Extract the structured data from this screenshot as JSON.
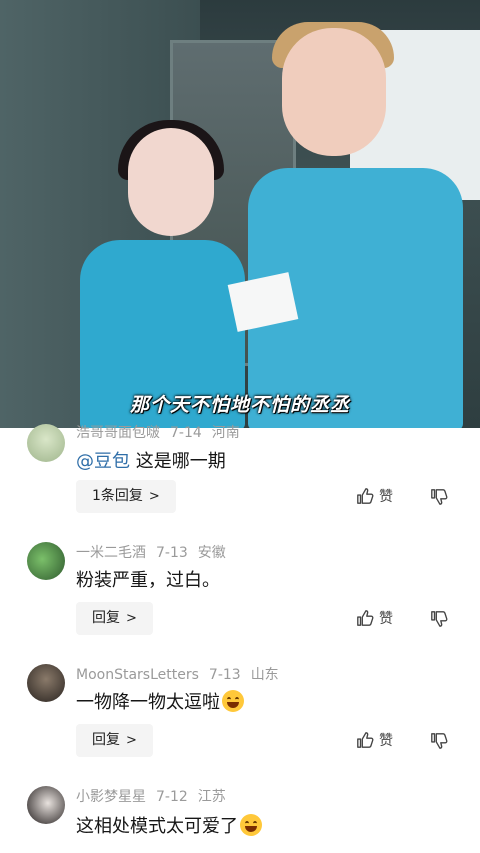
{
  "video": {
    "subtitle": "那个天不怕地不怕的丞丞"
  },
  "comments": [
    {
      "username": "浩哥哥面包啵",
      "date": "7-14",
      "location": "河南",
      "mention": "@豆包",
      "text": "这是哪一期",
      "reply_label": "1条回复",
      "like_label": "赞"
    },
    {
      "username": "一米二毛酒",
      "date": "7-13",
      "location": "安徽",
      "text": "粉装严重，过白。",
      "reply_label": "回复",
      "like_label": "赞"
    },
    {
      "username": "MoonStarsLetters",
      "date": "7-13",
      "location": "山东",
      "text": "一物降一物太逗啦",
      "reply_label": "回复",
      "like_label": "赞"
    },
    {
      "username": "小影梦星星",
      "date": "7-12",
      "location": "江苏",
      "text": "这相处模式太可爱了",
      "reply_label": "回复",
      "like_label": "赞"
    }
  ],
  "icons": {
    "like": "thumbs-up-icon",
    "dislike": "thumbs-down-icon",
    "chevron": "chevron-right-icon",
    "emoji": "grinning-emoji-icon"
  },
  "colors": {
    "mention": "#2f6ea8",
    "meta": "#9a9a9a",
    "reply_bg": "#f4f4f4"
  }
}
